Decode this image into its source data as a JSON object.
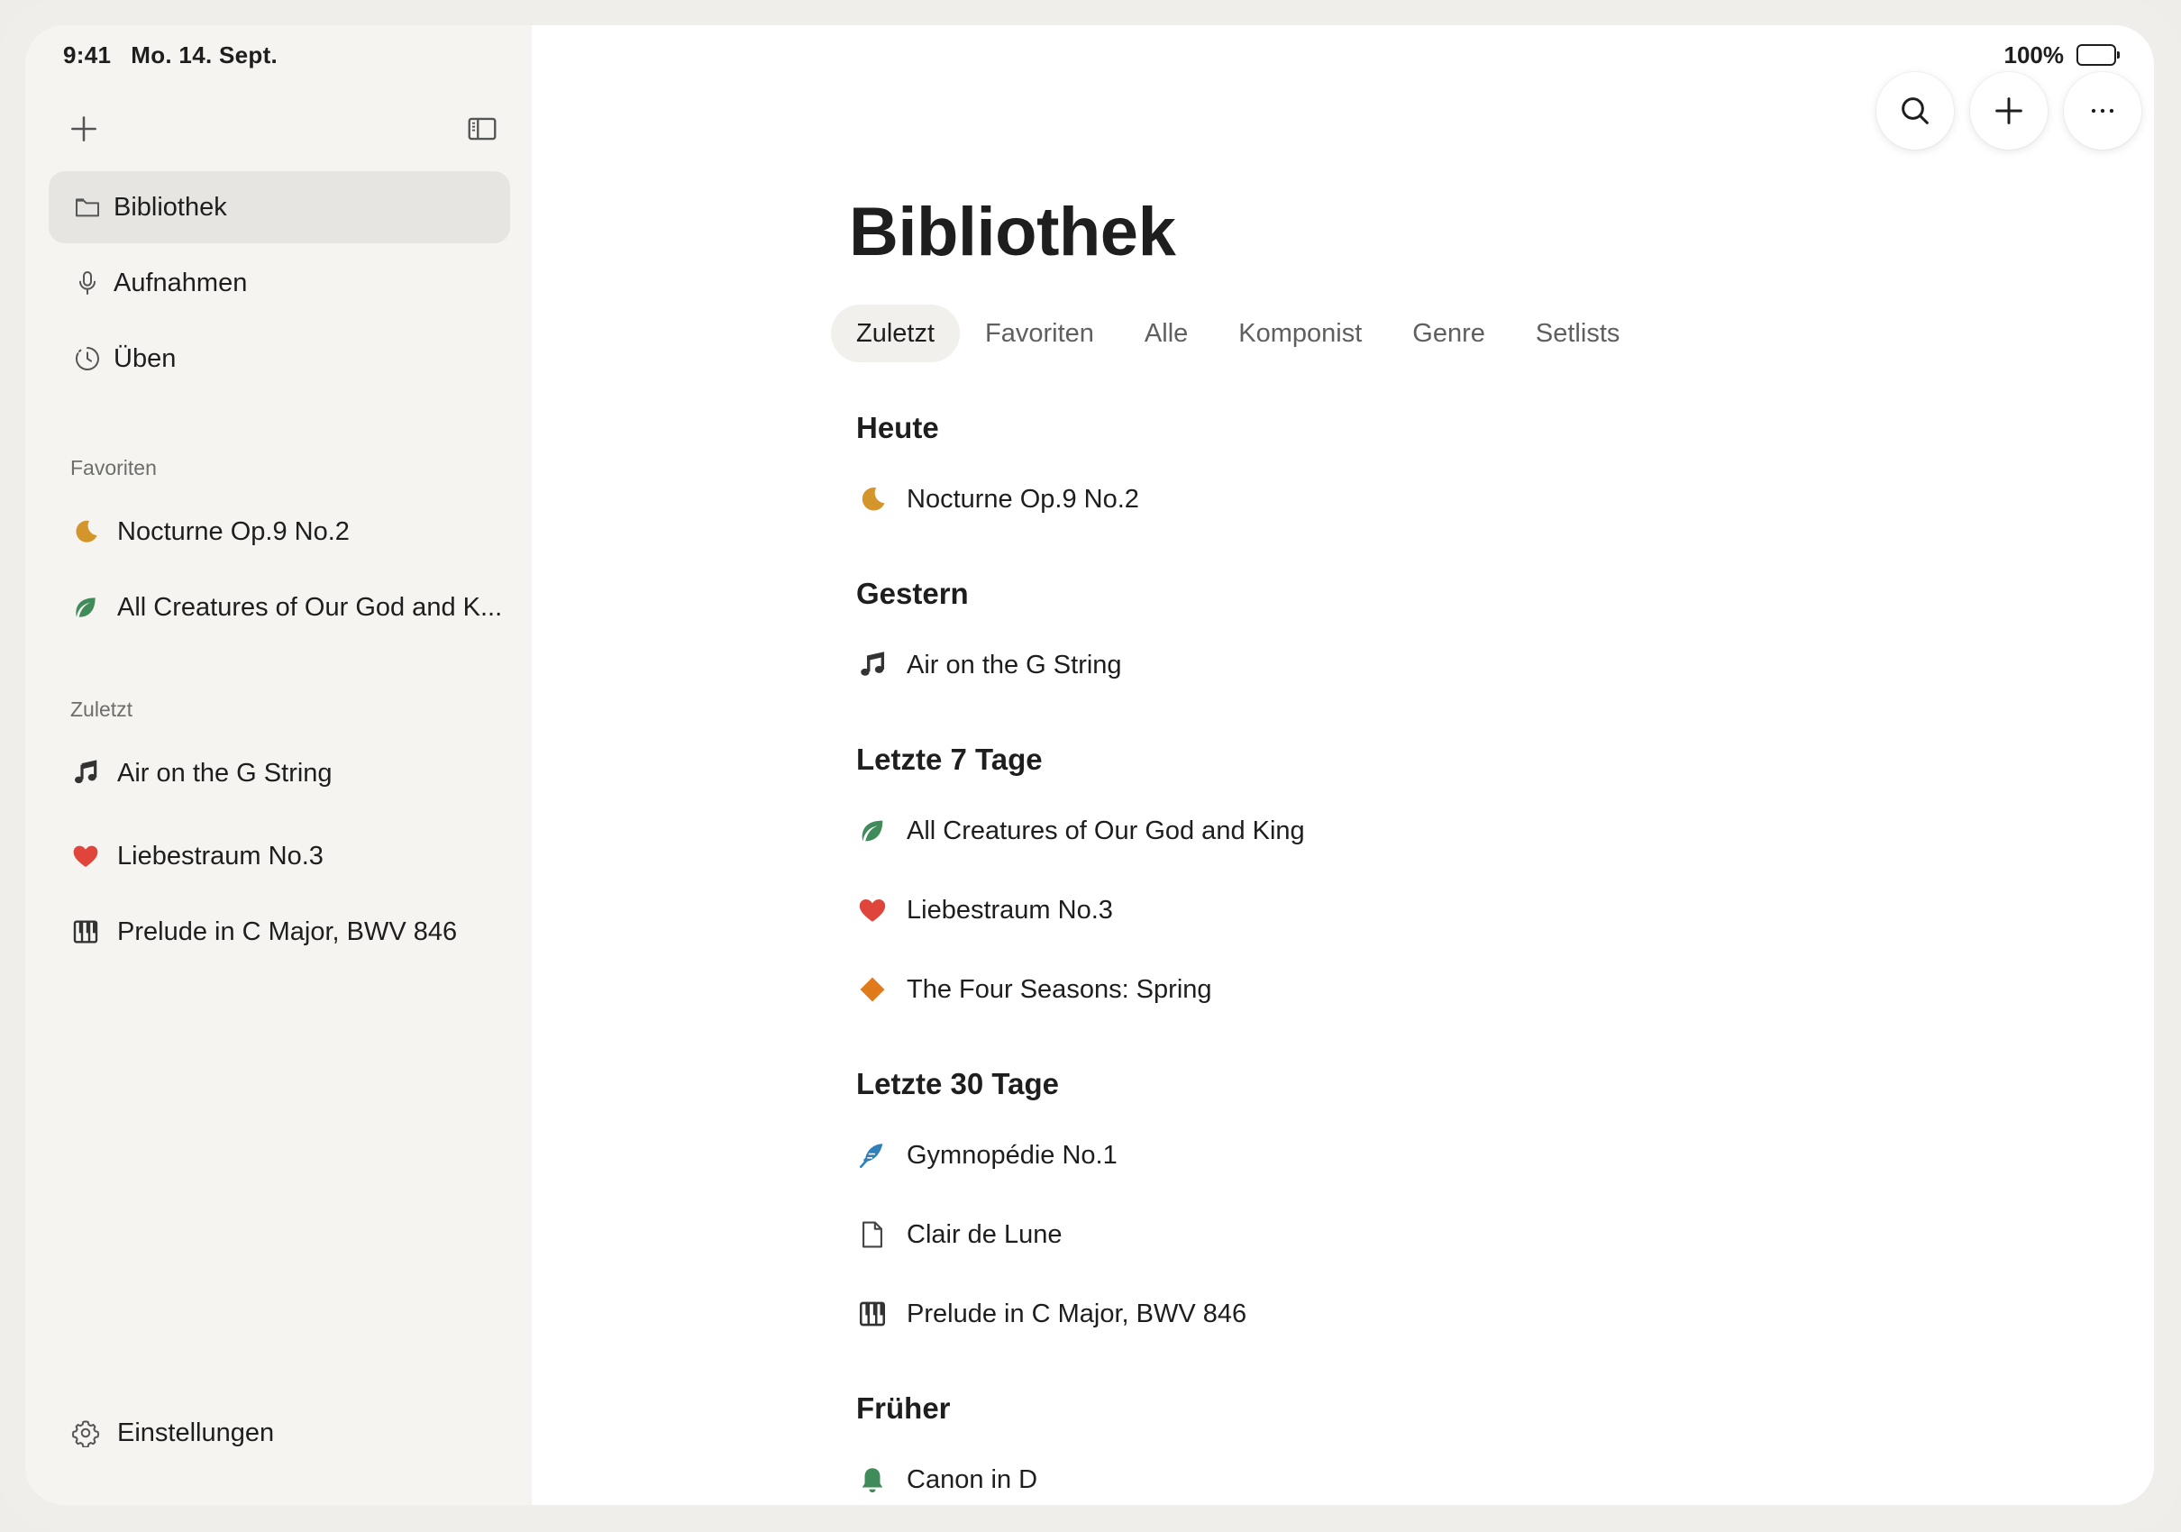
{
  "status_bar": {
    "time": "9:41",
    "date": "Mo. 14. Sept.",
    "battery": "100%"
  },
  "colors": {
    "moon": "#d4952a",
    "leaf": "#3f8b5a",
    "heart": "#e0453c",
    "diamond": "#e07a1a",
    "feather": "#2f7fb8",
    "bell": "#3f8b5a"
  },
  "sidebar": {
    "nav": [
      {
        "label": "Bibliothek",
        "icon": "folder-icon",
        "active": true
      },
      {
        "label": "Aufnahmen",
        "icon": "microphone-icon",
        "active": false
      },
      {
        "label": "Üben",
        "icon": "practice-timer-icon",
        "active": false
      }
    ],
    "favorites_label": "Favoriten",
    "favorites": [
      {
        "label": "Nocturne Op.9 No.2",
        "icon": "moon-icon"
      },
      {
        "label": "All Creatures of Our God and K...",
        "icon": "leaf-icon"
      }
    ],
    "recent_label": "Zuletzt",
    "recent": [
      {
        "label": "Air on the G String",
        "icon": "music-note-icon"
      },
      {
        "label": "Liebestraum No.3",
        "icon": "heart-icon"
      },
      {
        "label": "Prelude in C Major, BWV 846",
        "icon": "piano-icon"
      }
    ],
    "settings_label": "Einstellungen"
  },
  "main": {
    "title": "Bibliothek",
    "tabs": [
      "Zuletzt",
      "Favoriten",
      "Alle",
      "Komponist",
      "Genre",
      "Setlists"
    ],
    "active_tab": "Zuletzt",
    "groups": [
      {
        "title": "Heute",
        "items": [
          {
            "label": "Nocturne Op.9 No.2",
            "icon": "moon-icon"
          }
        ]
      },
      {
        "title": "Gestern",
        "items": [
          {
            "label": "Air on the G String",
            "icon": "music-note-icon"
          }
        ]
      },
      {
        "title": "Letzte 7 Tage",
        "items": [
          {
            "label": "All Creatures of Our God and King",
            "icon": "leaf-icon"
          },
          {
            "label": "Liebestraum No.3",
            "icon": "heart-icon"
          },
          {
            "label": "The Four Seasons: Spring",
            "icon": "diamond-icon"
          }
        ]
      },
      {
        "title": "Letzte 30 Tage",
        "items": [
          {
            "label": "Gymnopédie No.1",
            "icon": "feather-icon"
          },
          {
            "label": "Clair de Lune",
            "icon": "document-icon"
          },
          {
            "label": "Prelude in C Major, BWV 846",
            "icon": "piano-icon"
          }
        ]
      },
      {
        "title": "Früher",
        "items": [
          {
            "label": "Canon in D",
            "icon": "bell-icon"
          }
        ]
      }
    ]
  }
}
